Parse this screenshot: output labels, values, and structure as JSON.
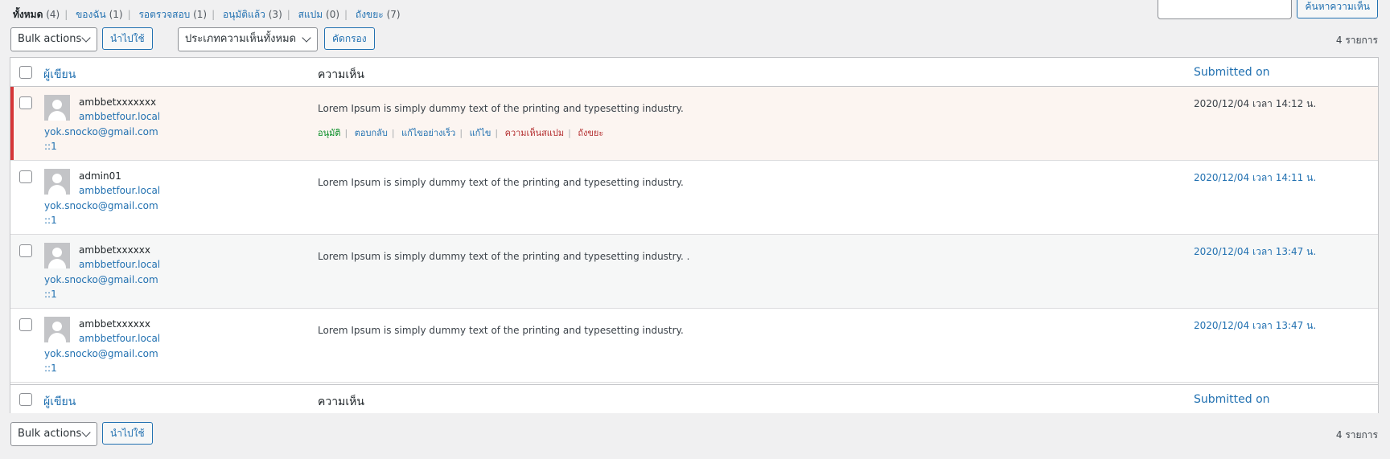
{
  "status_links": [
    {
      "label": "ทั้งหมด",
      "count": "(4)",
      "current": true
    },
    {
      "label": "ของฉัน",
      "count": "(1)"
    },
    {
      "label": "รอตรวจสอบ",
      "count": "(1)"
    },
    {
      "label": "อนุมัติแล้ว",
      "count": "(3)"
    },
    {
      "label": "สแปม",
      "count": "(0)"
    },
    {
      "label": "ถังขยะ",
      "count": "(7)"
    }
  ],
  "search": {
    "button": "ค้นหาความเห็น"
  },
  "tablenav": {
    "bulk_actions": "Bulk actions",
    "apply": "นำไปใช้",
    "comment_type": "ประเภทความเห็นทั้งหมด",
    "filter": "คัดกรอง",
    "count": "4 รายการ"
  },
  "columns": {
    "author": "ผู้เขียน",
    "comment": "ความเห็น",
    "date": "Submitted on"
  },
  "row_actions": {
    "approve": "อนุมัติ",
    "reply": "ตอบกลับ",
    "quick_edit": "แก้ไขอย่างเร็ว",
    "edit": "แก้ไข",
    "spam": "ความเห็นสแปม",
    "trash": "ถังขยะ"
  },
  "comments": [
    {
      "author": "ambbetxxxxxxx",
      "url": "ambbetfour.local",
      "email": "yok.snocko@gmail.com",
      "ip": "::1",
      "text": "Lorem Ipsum is simply dummy text of the printing and typesetting industry.",
      "date": "2020/12/04 เวลา 14:12 น.",
      "status": "unapproved"
    },
    {
      "author": "admin01",
      "url": "ambbetfour.local",
      "email": "yok.snocko@gmail.com",
      "ip": "::1",
      "text": "Lorem Ipsum is simply dummy text of the printing and typesetting industry.",
      "date": "2020/12/04 เวลา 14:11 น.",
      "status": "approved"
    },
    {
      "author": "ambbetxxxxxx",
      "url": "ambbetfour.local",
      "email": "yok.snocko@gmail.com",
      "ip": "::1",
      "text": "Lorem Ipsum is simply dummy text of the printing and typesetting industry. .",
      "date": "2020/12/04 เวลา 13:47 น.",
      "status": "approved"
    },
    {
      "author": "ambbetxxxxxx",
      "url": "ambbetfour.local",
      "email": "yok.snocko@gmail.com",
      "ip": "::1",
      "text": "Lorem Ipsum is simply dummy text of the printing and typesetting industry.",
      "date": "2020/12/04 เวลา 13:47 น.",
      "status": "approved"
    }
  ]
}
